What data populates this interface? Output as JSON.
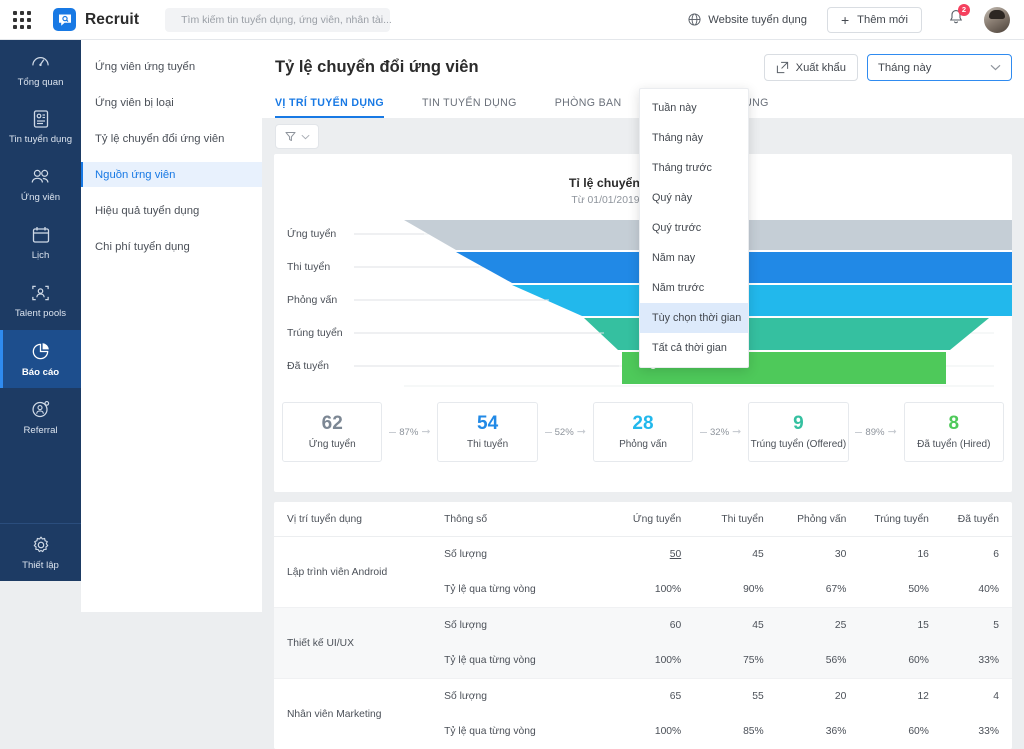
{
  "topbar": {
    "apps_icon": "grid-apps-icon",
    "brand": "Recruit",
    "search_placeholder": "Tìm kiếm tin tuyển dụng, ứng viên, nhân tài...",
    "website_link": "Website tuyển dụng",
    "add_new": "Thêm mới",
    "notification_count": "2"
  },
  "rail": {
    "items": [
      {
        "label": "Tổng quan",
        "icon": "dashboard-icon",
        "active": false
      },
      {
        "label": "Tin tuyển dụng",
        "icon": "job-card-icon",
        "active": false
      },
      {
        "label": "Ứng viên",
        "icon": "users-icon",
        "active": false
      },
      {
        "label": "Lịch",
        "icon": "calendar-icon",
        "active": false
      },
      {
        "label": "Talent pools",
        "icon": "talent-pool-icon",
        "active": false
      },
      {
        "label": "Báo cáo",
        "icon": "report-pie-icon",
        "active": true
      },
      {
        "label": "Referral",
        "icon": "referral-icon",
        "active": false
      }
    ],
    "bottom": {
      "label": "Thiết lập",
      "icon": "gear-icon"
    }
  },
  "subnav": {
    "items": [
      {
        "label": "Ứng viên ứng tuyển",
        "active": false
      },
      {
        "label": "Ứng viên bị loại",
        "active": false
      },
      {
        "label": "Tỷ lệ chuyển đổi ứng viên",
        "active": false
      },
      {
        "label": "Nguồn ứng viên",
        "active": true
      },
      {
        "label": "Hiệu quả tuyển dụng",
        "active": false
      },
      {
        "label": "Chi phí tuyển dụng",
        "active": false
      }
    ]
  },
  "header": {
    "title": "Tỷ lệ chuyển đổi ứng viên",
    "export_label": "Xuất khẩu",
    "range_value": "Tháng này",
    "tabs": [
      {
        "label": "VỊ TRÍ TUYỂN DỤNG",
        "active": true
      },
      {
        "label": "TIN TUYỂN DỤNG",
        "active": false
      },
      {
        "label": "PHÒNG BAN",
        "active": false
      },
      {
        "label": "VÒNG TUYỂN DỤNG",
        "active": false
      }
    ]
  },
  "dropdown": {
    "options": [
      {
        "label": "Tuần này",
        "highlighted": false
      },
      {
        "label": "Tháng này",
        "highlighted": false
      },
      {
        "label": "Tháng trước",
        "highlighted": false
      },
      {
        "label": "Quý này",
        "highlighted": false
      },
      {
        "label": "Quý trước",
        "highlighted": false
      },
      {
        "label": "Năm nay",
        "highlighted": false
      },
      {
        "label": "Năm trước",
        "highlighted": false
      },
      {
        "label": "Tùy chọn thời gian",
        "highlighted": true
      },
      {
        "label": "Tất cả thời gian",
        "highlighted": false
      }
    ]
  },
  "chart_data": {
    "type": "bar",
    "subtype": "funnel",
    "title": "Tỉ lệ chuyển đổi ứng viên",
    "subtitle": "Từ 01/01/2019 đến 31/12/2019",
    "xlabel": "",
    "ylabel": "",
    "grid": true,
    "legend": "none",
    "categories": [
      "Ứng tuyển",
      "Thi tuyển",
      "Phỏng vấn",
      "Trúng tuyển",
      "Đã tuyển"
    ],
    "values": [
      62,
      54,
      28,
      9,
      8
    ],
    "colors": [
      "#c5ced6",
      "#2189e6",
      "#22b8ec",
      "#35c0a0",
      "#4ec95a"
    ],
    "stage_widths_pct": [
      100,
      87,
      74,
      45,
      28
    ],
    "conversions": [
      "87%",
      "52%",
      "32%",
      "89%"
    ]
  },
  "stats": {
    "cards": [
      {
        "value": "62",
        "label": "Ứng tuyển",
        "color": "#7c8794"
      },
      {
        "value": "54",
        "label": "Thi tuyển",
        "color": "#2189e6"
      },
      {
        "value": "28",
        "label": "Phỏng vấn",
        "color": "#22b8ec"
      },
      {
        "value": "9",
        "label": "Trúng tuyển (Offered)",
        "color": "#35c0a0"
      },
      {
        "value": "8",
        "label": "Đã tuyển (Hired)",
        "color": "#4ec95a"
      }
    ],
    "conversions": [
      "87%",
      "52%",
      "32%",
      "89%"
    ]
  },
  "table": {
    "columns": [
      "Vị trí tuyển dụng",
      "Thông số",
      "Ứng tuyển",
      "Thi tuyển",
      "Phỏng vấn",
      "Trúng tuyển",
      "Đã tuyển"
    ],
    "metric_count_label": "Số lượng",
    "metric_rate_label": "Tỷ lệ qua từng vòng",
    "rows": [
      {
        "position": "Lập trình viên Android",
        "counts": [
          "50",
          "45",
          "30",
          "16",
          "6"
        ],
        "rates": [
          "100%",
          "90%",
          "67%",
          "50%",
          "40%"
        ],
        "count_underlined_index": 0
      },
      {
        "position": "Thiết kế UI/UX",
        "counts": [
          "60",
          "45",
          "25",
          "15",
          "5"
        ],
        "rates": [
          "100%",
          "75%",
          "56%",
          "60%",
          "33%"
        ],
        "count_underlined_index": -1
      },
      {
        "position": "Nhân viên Marketing",
        "counts": [
          "65",
          "55",
          "20",
          "12",
          "4"
        ],
        "rates": [
          "100%",
          "85%",
          "36%",
          "60%",
          "33%"
        ],
        "count_underlined_index": -1
      }
    ]
  }
}
